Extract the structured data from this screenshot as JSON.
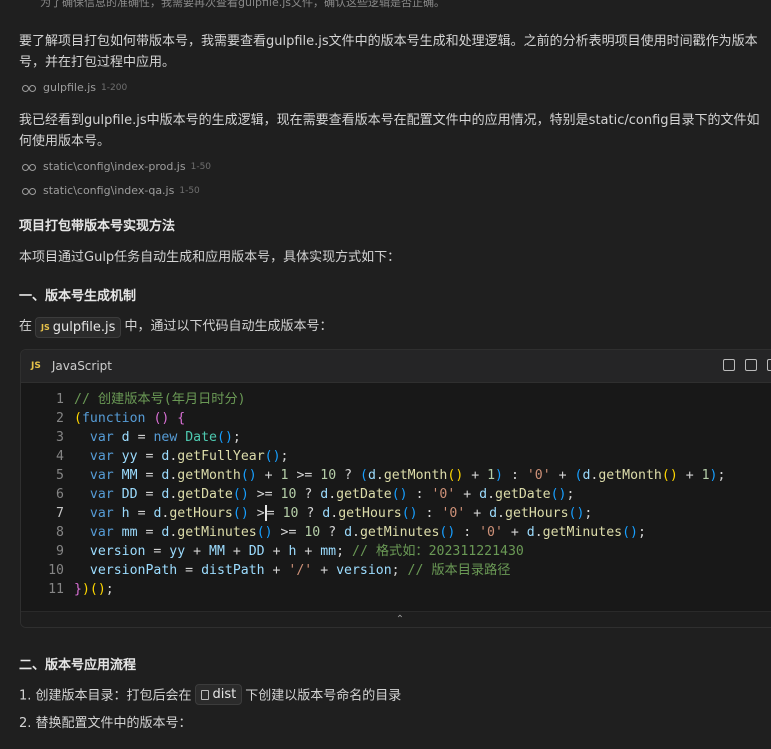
{
  "top_fade": "为了确保信息的准确性，我需要再次查看gulpfile.js文件，确认这些逻辑是否正确。",
  "para1": "要了解项目打包如何带版本号，我需要查看gulpfile.js文件中的版本号生成和处理逻辑。之前的分析表明项目使用时间戳作为版本号，并在打包过程中应用。",
  "ref1": {
    "file": "gulpfile.js",
    "range": "1-200"
  },
  "para2": "我已经看到gulpfile.js中版本号的生成逻辑，现在需要查看版本号在配置文件中的应用情况，特别是static/config目录下的文件如何使用版本号。",
  "ref2": {
    "file": "static\\config\\index-prod.js",
    "range": "1-50"
  },
  "ref3": {
    "file": "static\\config\\index-qa.js",
    "range": "1-50"
  },
  "heading_main": "项目打包带版本号实现方法",
  "intro": "本项目通过Gulp任务自动生成和应用版本号，具体实现方式如下：",
  "section1": "一、版本号生成机制",
  "section1_text": {
    "prefix": "在",
    "chip_badge": "JS",
    "chip_file": "gulpfile.js",
    "suffix": "中，通过以下代码自动生成版本号："
  },
  "code": {
    "badge": "JS",
    "language": "JavaScript",
    "active_line": 7,
    "line_numbers": [
      "1",
      "2",
      "3",
      "4",
      "5",
      "6",
      "7",
      "8",
      "9",
      "10",
      "11"
    ],
    "lines": {
      "l1_comment": "// 创建版本号(年月日时分)",
      "l9_comment": "// 格式如：202311221430",
      "l10_comment": "// 版本目录路径",
      "string_zero": "'0'",
      "string_slash": "'/'"
    }
  },
  "section2": "二、版本号应用流程",
  "step1": {
    "prefix": "1. 创建版本目录：打包后会在",
    "chip": "dist",
    "suffix": "下创建以版本号命名的目录"
  },
  "step2": "2. 替换配置文件中的版本号："
}
